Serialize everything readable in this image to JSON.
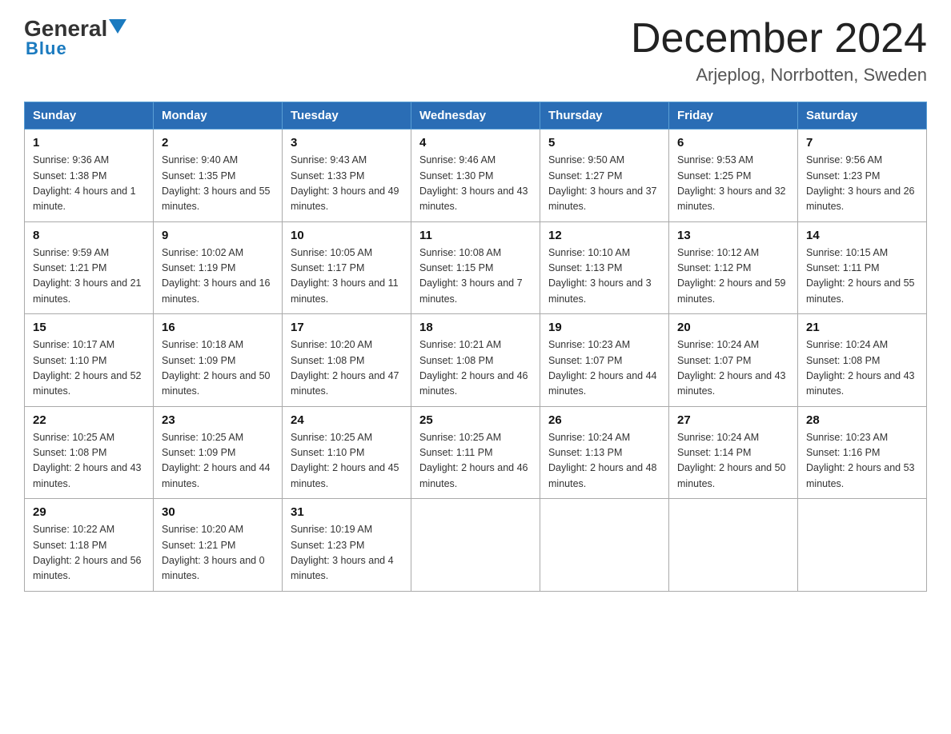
{
  "header": {
    "logo_general": "General",
    "logo_blue": "Blue",
    "month_title": "December 2024",
    "location": "Arjeplog, Norrbotten, Sweden"
  },
  "days_of_week": [
    "Sunday",
    "Monday",
    "Tuesday",
    "Wednesday",
    "Thursday",
    "Friday",
    "Saturday"
  ],
  "weeks": [
    [
      {
        "day": "1",
        "sunrise": "9:36 AM",
        "sunset": "1:38 PM",
        "daylight": "4 hours and 1 minute."
      },
      {
        "day": "2",
        "sunrise": "9:40 AM",
        "sunset": "1:35 PM",
        "daylight": "3 hours and 55 minutes."
      },
      {
        "day": "3",
        "sunrise": "9:43 AM",
        "sunset": "1:33 PM",
        "daylight": "3 hours and 49 minutes."
      },
      {
        "day": "4",
        "sunrise": "9:46 AM",
        "sunset": "1:30 PM",
        "daylight": "3 hours and 43 minutes."
      },
      {
        "day": "5",
        "sunrise": "9:50 AM",
        "sunset": "1:27 PM",
        "daylight": "3 hours and 37 minutes."
      },
      {
        "day": "6",
        "sunrise": "9:53 AM",
        "sunset": "1:25 PM",
        "daylight": "3 hours and 32 minutes."
      },
      {
        "day": "7",
        "sunrise": "9:56 AM",
        "sunset": "1:23 PM",
        "daylight": "3 hours and 26 minutes."
      }
    ],
    [
      {
        "day": "8",
        "sunrise": "9:59 AM",
        "sunset": "1:21 PM",
        "daylight": "3 hours and 21 minutes."
      },
      {
        "day": "9",
        "sunrise": "10:02 AM",
        "sunset": "1:19 PM",
        "daylight": "3 hours and 16 minutes."
      },
      {
        "day": "10",
        "sunrise": "10:05 AM",
        "sunset": "1:17 PM",
        "daylight": "3 hours and 11 minutes."
      },
      {
        "day": "11",
        "sunrise": "10:08 AM",
        "sunset": "1:15 PM",
        "daylight": "3 hours and 7 minutes."
      },
      {
        "day": "12",
        "sunrise": "10:10 AM",
        "sunset": "1:13 PM",
        "daylight": "3 hours and 3 minutes."
      },
      {
        "day": "13",
        "sunrise": "10:12 AM",
        "sunset": "1:12 PM",
        "daylight": "2 hours and 59 minutes."
      },
      {
        "day": "14",
        "sunrise": "10:15 AM",
        "sunset": "1:11 PM",
        "daylight": "2 hours and 55 minutes."
      }
    ],
    [
      {
        "day": "15",
        "sunrise": "10:17 AM",
        "sunset": "1:10 PM",
        "daylight": "2 hours and 52 minutes."
      },
      {
        "day": "16",
        "sunrise": "10:18 AM",
        "sunset": "1:09 PM",
        "daylight": "2 hours and 50 minutes."
      },
      {
        "day": "17",
        "sunrise": "10:20 AM",
        "sunset": "1:08 PM",
        "daylight": "2 hours and 47 minutes."
      },
      {
        "day": "18",
        "sunrise": "10:21 AM",
        "sunset": "1:08 PM",
        "daylight": "2 hours and 46 minutes."
      },
      {
        "day": "19",
        "sunrise": "10:23 AM",
        "sunset": "1:07 PM",
        "daylight": "2 hours and 44 minutes."
      },
      {
        "day": "20",
        "sunrise": "10:24 AM",
        "sunset": "1:07 PM",
        "daylight": "2 hours and 43 minutes."
      },
      {
        "day": "21",
        "sunrise": "10:24 AM",
        "sunset": "1:08 PM",
        "daylight": "2 hours and 43 minutes."
      }
    ],
    [
      {
        "day": "22",
        "sunrise": "10:25 AM",
        "sunset": "1:08 PM",
        "daylight": "2 hours and 43 minutes."
      },
      {
        "day": "23",
        "sunrise": "10:25 AM",
        "sunset": "1:09 PM",
        "daylight": "2 hours and 44 minutes."
      },
      {
        "day": "24",
        "sunrise": "10:25 AM",
        "sunset": "1:10 PM",
        "daylight": "2 hours and 45 minutes."
      },
      {
        "day": "25",
        "sunrise": "10:25 AM",
        "sunset": "1:11 PM",
        "daylight": "2 hours and 46 minutes."
      },
      {
        "day": "26",
        "sunrise": "10:24 AM",
        "sunset": "1:13 PM",
        "daylight": "2 hours and 48 minutes."
      },
      {
        "day": "27",
        "sunrise": "10:24 AM",
        "sunset": "1:14 PM",
        "daylight": "2 hours and 50 minutes."
      },
      {
        "day": "28",
        "sunrise": "10:23 AM",
        "sunset": "1:16 PM",
        "daylight": "2 hours and 53 minutes."
      }
    ],
    [
      {
        "day": "29",
        "sunrise": "10:22 AM",
        "sunset": "1:18 PM",
        "daylight": "2 hours and 56 minutes."
      },
      {
        "day": "30",
        "sunrise": "10:20 AM",
        "sunset": "1:21 PM",
        "daylight": "3 hours and 0 minutes."
      },
      {
        "day": "31",
        "sunrise": "10:19 AM",
        "sunset": "1:23 PM",
        "daylight": "3 hours and 4 minutes."
      },
      null,
      null,
      null,
      null
    ]
  ]
}
